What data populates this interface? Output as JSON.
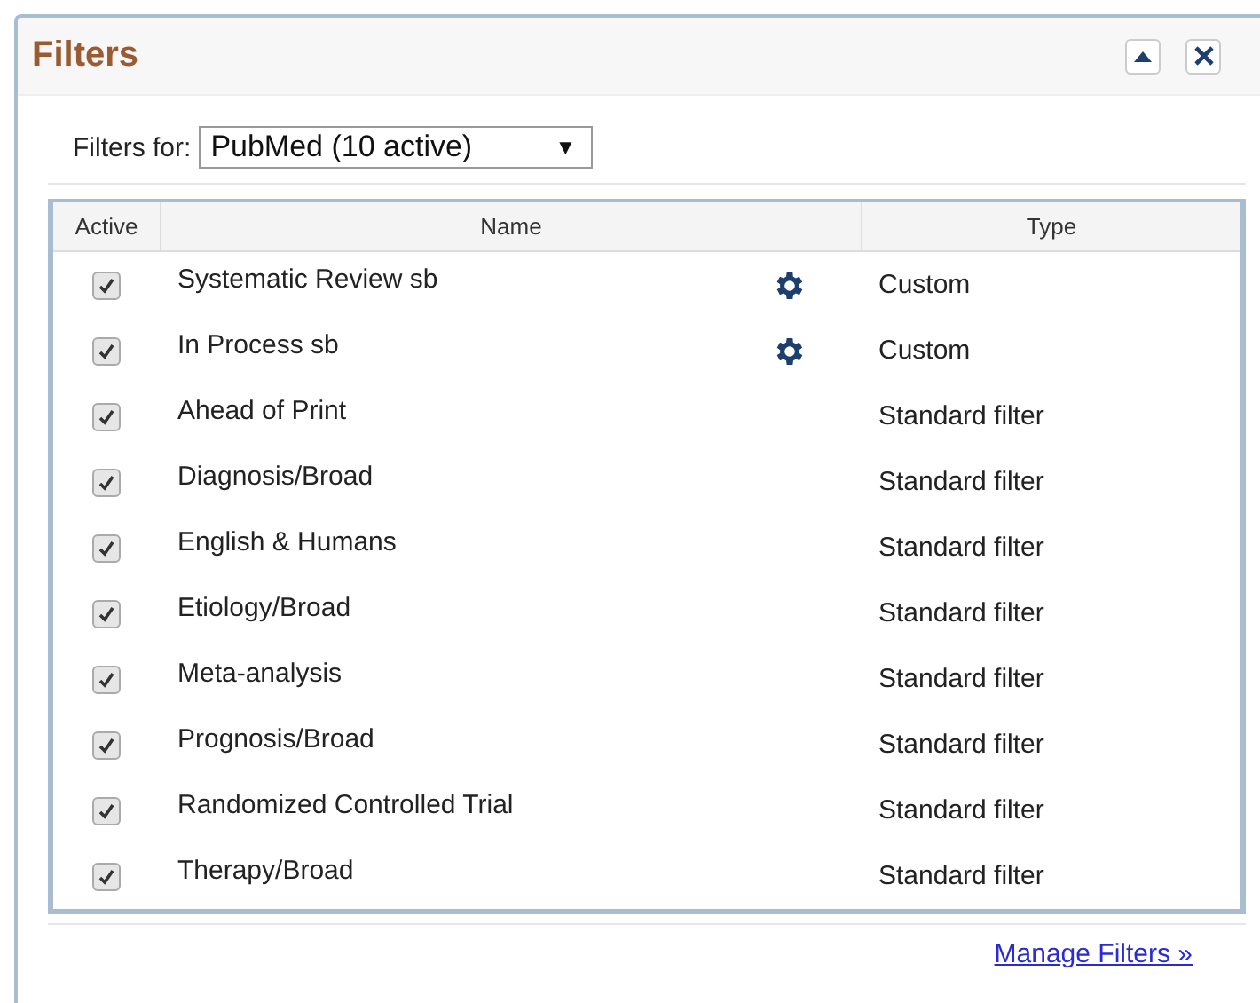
{
  "panel": {
    "title": "Filters"
  },
  "filter_select": {
    "label": "Filters for:",
    "value": "PubMed (10 active)",
    "arrow": "▼"
  },
  "table": {
    "columns": [
      "Active",
      "Name",
      "Type"
    ],
    "rows": [
      {
        "name": "Systematic Review sb",
        "type": "Custom",
        "checked": true,
        "kind": "custom"
      },
      {
        "name": "In Process sb",
        "type": "Custom",
        "checked": true,
        "kind": "custom"
      },
      {
        "name": "Ahead of Print",
        "type": "Standard filter",
        "checked": true,
        "kind": "standard"
      },
      {
        "name": "Diagnosis/Broad",
        "type": "Standard filter",
        "checked": true,
        "kind": "standard"
      },
      {
        "name": "English & Humans",
        "type": "Standard filter",
        "checked": true,
        "kind": "standard"
      },
      {
        "name": "Etiology/Broad",
        "type": "Standard filter",
        "checked": true,
        "kind": "standard"
      },
      {
        "name": "Meta-analysis",
        "type": "Standard filter",
        "checked": true,
        "kind": "standard"
      },
      {
        "name": "Prognosis/Broad",
        "type": "Standard filter",
        "checked": true,
        "kind": "standard"
      },
      {
        "name": "Randomized Controlled Trial",
        "type": "Standard filter",
        "checked": true,
        "kind": "standard"
      },
      {
        "name": "Therapy/Broad",
        "type": "Standard filter",
        "checked": true,
        "kind": "standard"
      }
    ]
  },
  "manage_link": "Manage Filters »"
}
